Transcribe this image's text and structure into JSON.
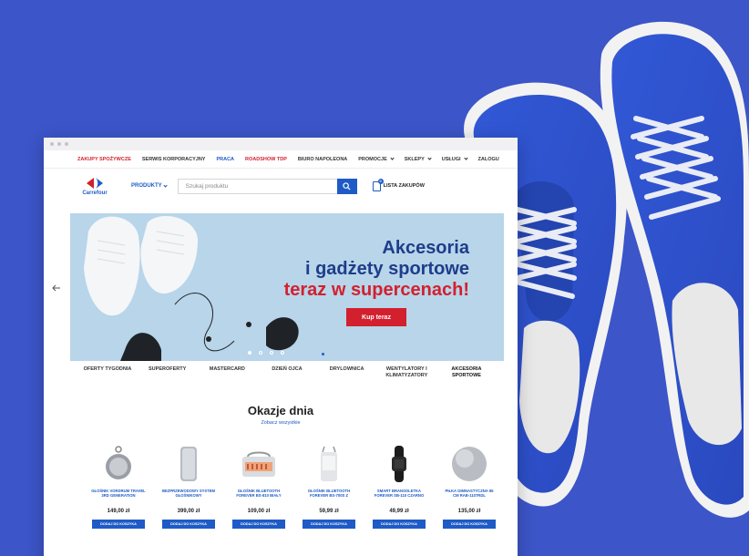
{
  "colors": {
    "background": "#3c55c8",
    "brand_blue": "#1e5bc6",
    "brand_red": "#d3202e",
    "hero_bg": "#b8d5ea"
  },
  "topnav": [
    {
      "label": "Zakupy spożywcze",
      "style": "red",
      "dropdown": false
    },
    {
      "label": "Serwis korporacyjny",
      "style": "normal",
      "dropdown": false
    },
    {
      "label": "Praca",
      "style": "blue",
      "dropdown": false
    },
    {
      "label": "Roadshow TDP",
      "style": "red",
      "dropdown": false
    },
    {
      "label": "Biuro Napoleona",
      "style": "normal",
      "dropdown": false
    },
    {
      "label": "Promocje",
      "style": "normal",
      "dropdown": true
    },
    {
      "label": "Sklepy",
      "style": "normal",
      "dropdown": true
    },
    {
      "label": "Usługi",
      "style": "normal",
      "dropdown": true
    },
    {
      "label": "Zalogu",
      "style": "normal",
      "dropdown": false
    }
  ],
  "header": {
    "logo_text": "Carrefour",
    "produkty_label": "Produkty",
    "search_placeholder": "Szukaj produktu",
    "lista_label": "Lista zakupów",
    "lista_count": "0"
  },
  "hero": {
    "line1": "Akcesoria",
    "line2": "i gadżety sportowe",
    "line3": "teraz w supercenach!",
    "cta": "Kup teraz"
  },
  "categories": [
    "Oferty tygodnia",
    "Superoferty",
    "Mastercard",
    "Dzień Ojca",
    "Drylownica",
    "Wentylatory i klimatyzatory",
    "Akcesoria sportowe"
  ],
  "section": {
    "title": "Okazje dnia",
    "link": "Zobacz wszystkie"
  },
  "products": [
    {
      "name": "Głośnik Vordrum Travel 3rd Generation",
      "price": "149,00 zł",
      "add": "Dodaj do koszyka",
      "icon": "speaker-round-icon"
    },
    {
      "name": "Bezprzewodowy system głośnikowy",
      "price": "399,00 zł",
      "add": "Dodaj do koszyka",
      "icon": "speaker-tower-icon"
    },
    {
      "name": "Głośnik Bluetooth Forever BS-810 biały",
      "price": "109,00 zł",
      "add": "Dodaj do koszyka",
      "icon": "radio-speaker-icon"
    },
    {
      "name": "Głośnik Bluetooth Forever BS-700S Z",
      "price": "59,99 zł",
      "add": "Dodaj do koszyka",
      "icon": "lantern-speaker-icon"
    },
    {
      "name": "Smart bransoletka Forever SB-110 czarno",
      "price": "49,99 zł",
      "add": "Dodaj do koszyka",
      "icon": "smart-band-icon"
    },
    {
      "name": "Piłka gimnastyczna 65 cm RAB-1107Rdl",
      "price": "135,00 zł",
      "add": "Dodaj do koszyka",
      "icon": "gym-ball-icon"
    }
  ]
}
